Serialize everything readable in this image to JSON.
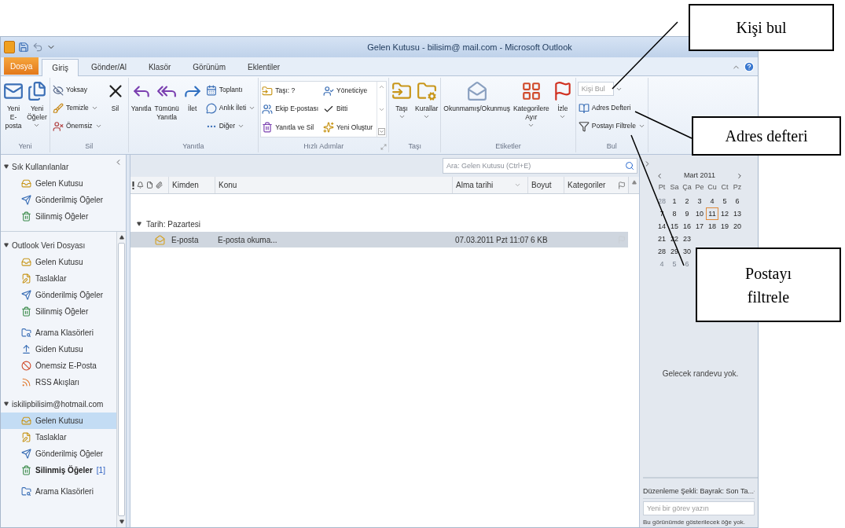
{
  "window": {
    "title": "Gelen Kutusu - bilisim@ mail.com - Microsoft Outlook"
  },
  "ribbon_tabs": [
    {
      "label": "Dosya",
      "kind": "file",
      "selected": false
    },
    {
      "label": "Giriş",
      "kind": "tab",
      "selected": true
    },
    {
      "label": "Gönder/Al",
      "kind": "tab",
      "selected": false
    },
    {
      "label": "Klasör",
      "kind": "tab",
      "selected": false
    },
    {
      "label": "Görünüm",
      "kind": "tab",
      "selected": false
    },
    {
      "label": "Eklentiler",
      "kind": "tab",
      "selected": false
    }
  ],
  "ribbon_groups": [
    {
      "label": "Yeni",
      "kind": "plain",
      "launcher": false,
      "controls": [
        {
          "kind": "large",
          "label": "Yeni E-posta",
          "dropdown": false
        },
        {
          "kind": "large",
          "label": "Yeni Öğeler",
          "dropdown": true
        }
      ]
    },
    {
      "label": "Sil",
      "kind": "plain",
      "launcher": false,
      "controls": [
        {
          "kind": "small",
          "label": "Yoksay",
          "dropdown": false
        },
        {
          "kind": "small",
          "label": "Temizle",
          "dropdown": true
        },
        {
          "kind": "small",
          "label": "Önemsiz",
          "dropdown": true
        },
        {
          "kind": "large",
          "label": "Sil",
          "dropdown": false
        }
      ]
    },
    {
      "label": "Yanıtla",
      "kind": "plain",
      "launcher": false,
      "controls": [
        {
          "kind": "large",
          "label": "Yanıtla",
          "dropdown": false
        },
        {
          "kind": "large",
          "label": "Tümünü Yanıtla",
          "dropdown": false
        },
        {
          "kind": "large",
          "label": "İlet",
          "dropdown": false
        },
        {
          "kind": "small",
          "label": "Toplantı",
          "dropdown": false
        },
        {
          "kind": "small",
          "label": "Anlık İleti",
          "dropdown": true
        },
        {
          "kind": "small",
          "label": "Diğer",
          "dropdown": true
        }
      ]
    },
    {
      "label": "Hızlı Adımlar",
      "kind": "gallery",
      "launcher": true,
      "controls": [
        {
          "kind": "small",
          "label": "Taşı: ?",
          "dropdown": false
        },
        {
          "kind": "small",
          "label": "Ekip E-postası",
          "dropdown": false
        },
        {
          "kind": "small",
          "label": "Yanıtla ve Sil",
          "dropdown": false
        },
        {
          "kind": "small",
          "label": "Yöneticiye",
          "dropdown": false
        },
        {
          "kind": "small",
          "label": "Bitti",
          "dropdown": false
        },
        {
          "kind": "small",
          "label": "Yeni Oluştur",
          "dropdown": false
        }
      ]
    },
    {
      "label": "Taşı",
      "kind": "plain",
      "launcher": false,
      "controls": [
        {
          "kind": "large",
          "label": "Taşı",
          "dropdown": true
        },
        {
          "kind": "large",
          "label": "Kurallar",
          "dropdown": true
        }
      ]
    },
    {
      "label": "Etiketler",
      "kind": "plain",
      "launcher": false,
      "controls": [
        {
          "kind": "large",
          "label": "Okunmamış/Okunmuş",
          "dropdown": false
        },
        {
          "kind": "large",
          "label": "Kategorilere Ayır",
          "dropdown": true
        },
        {
          "kind": "large",
          "label": "İzle",
          "dropdown": true
        }
      ]
    },
    {
      "label": "Bul",
      "kind": "plain",
      "launcher": false,
      "controls": [
        {
          "kind": "field",
          "placeholder": "Kişi Bul",
          "dropdown": true
        },
        {
          "kind": "small",
          "label": "Adres Defteri",
          "dropdown": false
        },
        {
          "kind": "small",
          "label": "Postayı Filtrele",
          "dropdown": true
        }
      ]
    }
  ],
  "nav": {
    "sections": [
      {
        "label": "Sık Kullanılanlar",
        "expanded": true,
        "blocks": [
          [
            {
              "label": "Gelen Kutusu",
              "kind": "inbox",
              "selected": false,
              "bold": false
            },
            {
              "label": "Gönderilmiş Öğeler",
              "kind": "sent",
              "selected": false,
              "bold": false
            },
            {
              "label": "Silinmiş Öğeler",
              "kind": "deleted",
              "selected": false,
              "bold": false
            }
          ]
        ]
      },
      {
        "label": "Outlook Veri Dosyası",
        "expanded": true,
        "blocks": [
          [
            {
              "label": "Gelen Kutusu",
              "kind": "inbox",
              "selected": false,
              "bold": false
            },
            {
              "label": "Taslaklar",
              "kind": "drafts",
              "selected": false,
              "bold": false
            },
            {
              "label": "Gönderilmiş Öğeler",
              "kind": "sent",
              "selected": false,
              "bold": false
            },
            {
              "label": "Silinmiş Öğeler",
              "kind": "deleted",
              "selected": false,
              "bold": false
            }
          ],
          [
            {
              "label": "Arama Klasörleri",
              "kind": "search",
              "selected": false,
              "bold": false
            },
            {
              "label": "Giden Kutusu",
              "kind": "outbox",
              "selected": false,
              "bold": false
            },
            {
              "label": "Önemsiz E-Posta",
              "kind": "junk",
              "selected": false,
              "bold": false
            },
            {
              "label": "RSS Akışları",
              "kind": "rss",
              "selected": false,
              "bold": false
            }
          ]
        ]
      },
      {
        "label": "iskilipbilisim@hotmail.com",
        "expanded": true,
        "blocks": [
          [
            {
              "label": "Gelen Kutusu",
              "kind": "inbox",
              "selected": true,
              "bold": false
            },
            {
              "label": "Taslaklar",
              "kind": "drafts",
              "selected": false,
              "bold": false
            },
            {
              "label": "Gönderilmiş Öğeler",
              "kind": "sent",
              "selected": false,
              "bold": false
            },
            {
              "label": "Silinmiş Öğeler",
              "kind": "deleted",
              "selected": false,
              "bold": true,
              "count": "[1]"
            }
          ],
          [
            {
              "label": "Arama Klasörleri",
              "kind": "search",
              "selected": false,
              "bold": false
            }
          ]
        ]
      }
    ]
  },
  "mail_list": {
    "search": {
      "placeholder": "Ara: Gelen Kutusu (Ctrl+E)"
    },
    "columns": [
      {
        "label": "Kimden",
        "sorted": false
      },
      {
        "label": "Konu",
        "sorted": false
      },
      {
        "label": "Alma tarihi",
        "sorted": true
      },
      {
        "label": "Boyut",
        "sorted": false
      },
      {
        "label": "Kategoriler",
        "sorted": false
      }
    ],
    "groups": [
      {
        "label": "Tarih: Pazartesi",
        "expanded": true,
        "rows": [
          {
            "from": "E-posta",
            "subject": "E-posta okuma...",
            "received": "07.03.2011 Pzt 11:07",
            "size": "6 KB",
            "selected": true
          }
        ]
      }
    ]
  },
  "todo_bar": {
    "calendar": {
      "month": "Mart 2011",
      "weekdays": [
        "Pt",
        "Sa",
        "Ça",
        "Pe",
        "Cu",
        "Ct",
        "Pz"
      ],
      "weeks": [
        [
          {
            "day": "28",
            "muted": true,
            "today": false
          },
          {
            "day": "1",
            "muted": false,
            "today": false
          },
          {
            "day": "2",
            "muted": false,
            "today": false
          },
          {
            "day": "3",
            "muted": false,
            "today": false
          },
          {
            "day": "4",
            "muted": false,
            "today": false
          },
          {
            "day": "5",
            "muted": false,
            "today": false
          },
          {
            "day": "6",
            "muted": false,
            "today": false
          }
        ],
        [
          {
            "day": "7",
            "muted": false,
            "today": false
          },
          {
            "day": "8",
            "muted": false,
            "today": false
          },
          {
            "day": "9",
            "muted": false,
            "today": false
          },
          {
            "day": "10",
            "muted": false,
            "today": false
          },
          {
            "day": "11",
            "muted": false,
            "today": true
          },
          {
            "day": "12",
            "muted": false,
            "today": false
          },
          {
            "day": "13",
            "muted": false,
            "today": false
          }
        ],
        [
          {
            "day": "14",
            "muted": false,
            "today": false
          },
          {
            "day": "15",
            "muted": false,
            "today": false
          },
          {
            "day": "16",
            "muted": false,
            "today": false
          },
          {
            "day": "17",
            "muted": false,
            "today": false
          },
          {
            "day": "18",
            "muted": false,
            "today": false
          },
          {
            "day": "19",
            "muted": false,
            "today": false
          },
          {
            "day": "20",
            "muted": false,
            "today": false
          }
        ],
        [
          {
            "day": "21",
            "muted": false,
            "today": false
          },
          {
            "day": "22",
            "muted": false,
            "today": false
          },
          {
            "day": "23",
            "muted": false,
            "today": false
          }
        ],
        [
          {
            "day": "28",
            "muted": false,
            "today": false
          },
          {
            "day": "29",
            "muted": false,
            "today": false
          },
          {
            "day": "30",
            "muted": false,
            "today": false
          }
        ],
        [
          {
            "day": "4",
            "muted": true,
            "today": false
          },
          {
            "day": "5",
            "muted": true,
            "today": false
          },
          {
            "day": "6",
            "muted": true,
            "today": false
          }
        ]
      ]
    },
    "appointments_note": "Gelecek randevu yok.",
    "tasks": {
      "arrange_by": "Düzenleme Şekli: Bayrak: Son Ta...",
      "new_task": {
        "placeholder": "Yeni bir görev yazın"
      },
      "empty_note": "Bu görünümde gösterilecek öğe yok."
    }
  },
  "callouts": [
    {
      "text": "Kişi bul"
    },
    {
      "text": "Adres defteri"
    },
    {
      "text": "Postayı filtrele"
    }
  ]
}
